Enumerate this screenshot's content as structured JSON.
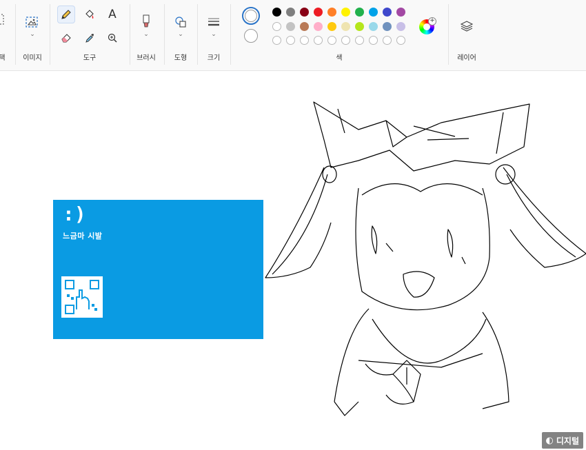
{
  "ribbon": {
    "groups": {
      "select": "택",
      "image": "이미지",
      "tools": "도구",
      "brushes": "브러시",
      "shapes": "도형",
      "size": "크기",
      "colors": "색",
      "layers": "레이어"
    },
    "text_tool_glyph": "A"
  },
  "palette": {
    "row1": [
      "#000000",
      "#7f7f7f",
      "#880015",
      "#ed1c24",
      "#ff7f27",
      "#fff200",
      "#22b14c",
      "#00a2e8",
      "#3f48cc",
      "#a349a4"
    ],
    "row2": [
      "#ffffff",
      "#c3c3c3",
      "#b97a57",
      "#ffaec9",
      "#ffc90e",
      "#efe4b0",
      "#b5e61d",
      "#99d9ea",
      "#7092be",
      "#c8bfe7"
    ],
    "row3_empty_count": 10,
    "primary": "#ffffff",
    "secondary": "#ffffff"
  },
  "canvas": {
    "bsod": {
      "face": ":)",
      "message": "느금마 시발",
      "background": "#0a9be3"
    }
  },
  "watermark": {
    "text": "디지털"
  }
}
